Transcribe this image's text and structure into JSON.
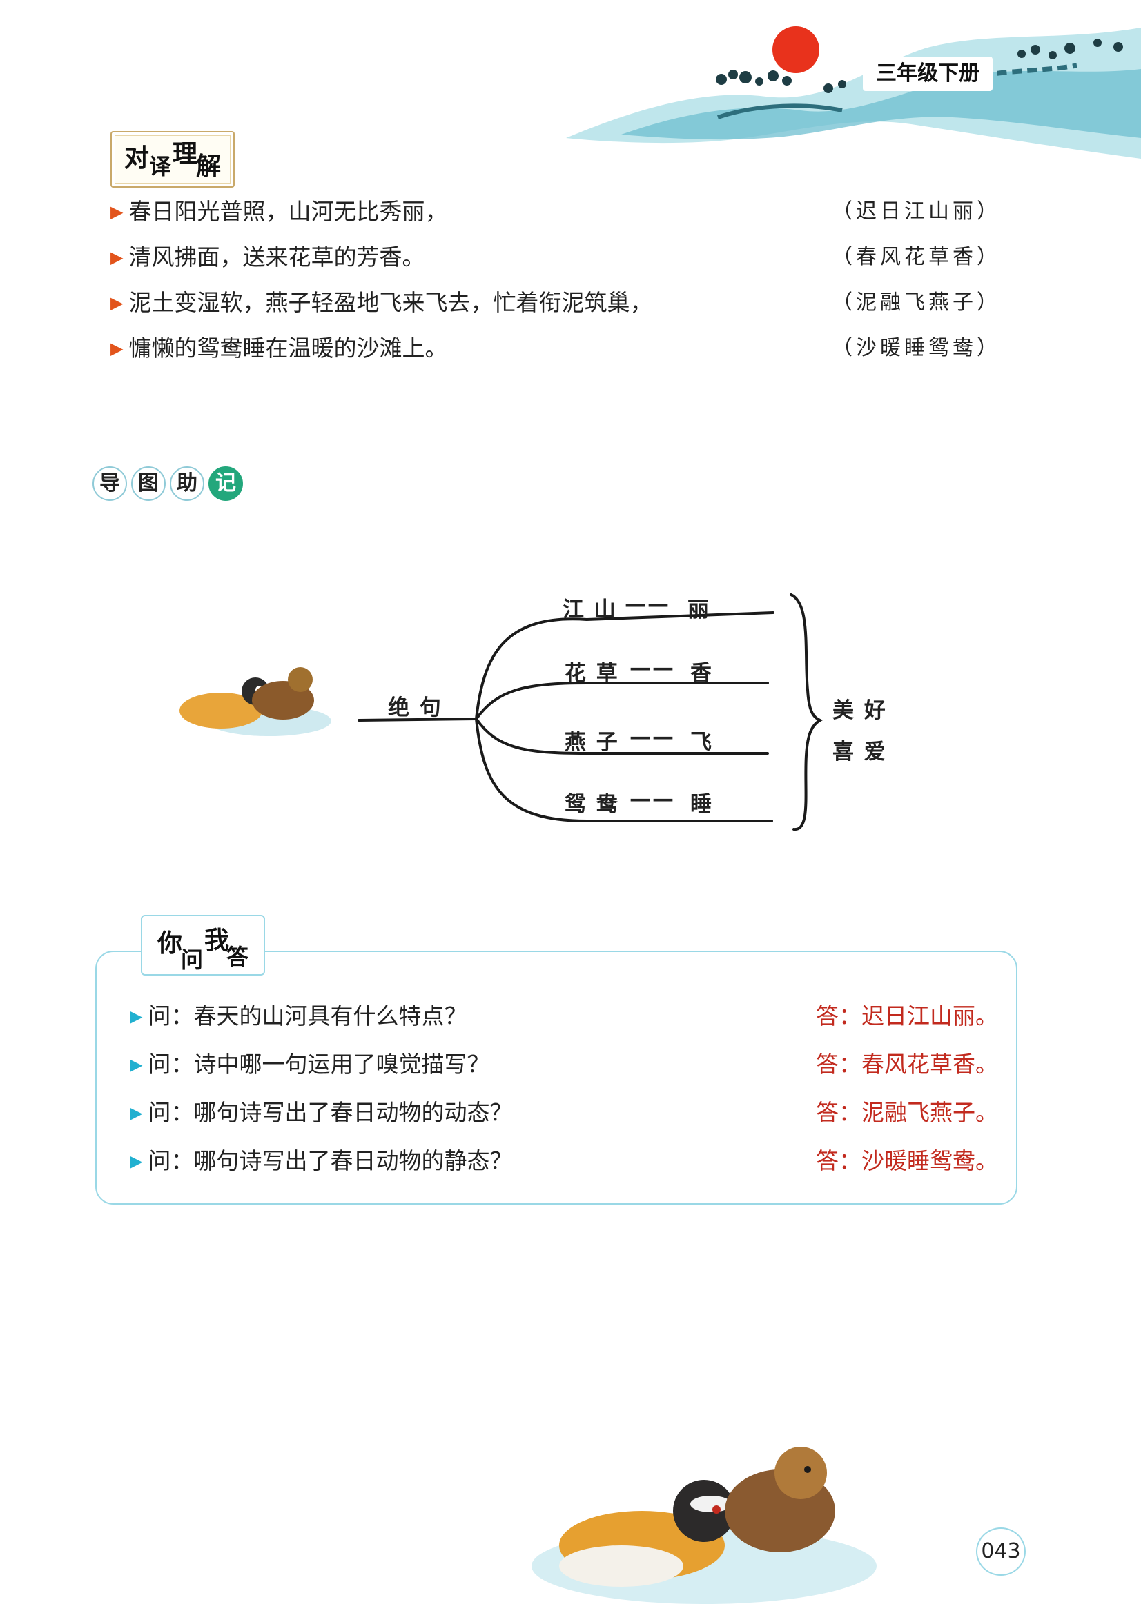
{
  "header": {
    "grade": "三年级下册"
  },
  "translation_section": {
    "badge": [
      "对",
      "译",
      "理",
      "解"
    ],
    "rows": [
      {
        "text": "春日阳光普照，山河无比秀丽，",
        "source": "（迟日江山丽）"
      },
      {
        "text": "清风拂面，送来花草的芳香。",
        "source": "（春风花草香）"
      },
      {
        "text": "泥土变湿软，燕子轻盈地飞来飞去，忙着衔泥筑巢，",
        "source": "（泥融飞燕子）"
      },
      {
        "text": "慵懒的鸳鸯睡在温暖的沙滩上。",
        "source": "（沙暖睡鸳鸯）"
      }
    ]
  },
  "mindmap_section": {
    "badge": [
      "导",
      "图",
      "助",
      "记"
    ],
    "root": "绝 句",
    "branches": [
      {
        "subject": "江 山",
        "feature": "丽"
      },
      {
        "subject": "花 草",
        "feature": "香"
      },
      {
        "subject": "燕 子",
        "feature": "飞"
      },
      {
        "subject": "鸳 鸯",
        "feature": "睡"
      }
    ],
    "summary": [
      "美 好",
      "喜 爱"
    ]
  },
  "qa_section": {
    "badge": [
      "你",
      "问",
      "我",
      "答"
    ],
    "rows": [
      {
        "question": "问：春天的山河具有什么特点？",
        "answer": "答：迟日江山丽。"
      },
      {
        "question": "问：诗中哪一句运用了嗅觉描写？",
        "answer": "答：春风花草香。"
      },
      {
        "question": "问：哪句诗写出了春日动物的动态？",
        "answer": "答：泥融飞燕子。"
      },
      {
        "question": "问：哪句诗写出了春日动物的静态？",
        "answer": "答：沙暖睡鸳鸯。"
      }
    ]
  },
  "page_number": "043",
  "colors": {
    "accent_orange": "#e2541c",
    "accent_blue": "#21b0d0",
    "answer_red": "#c22a1e",
    "sun_red": "#e8321c"
  }
}
